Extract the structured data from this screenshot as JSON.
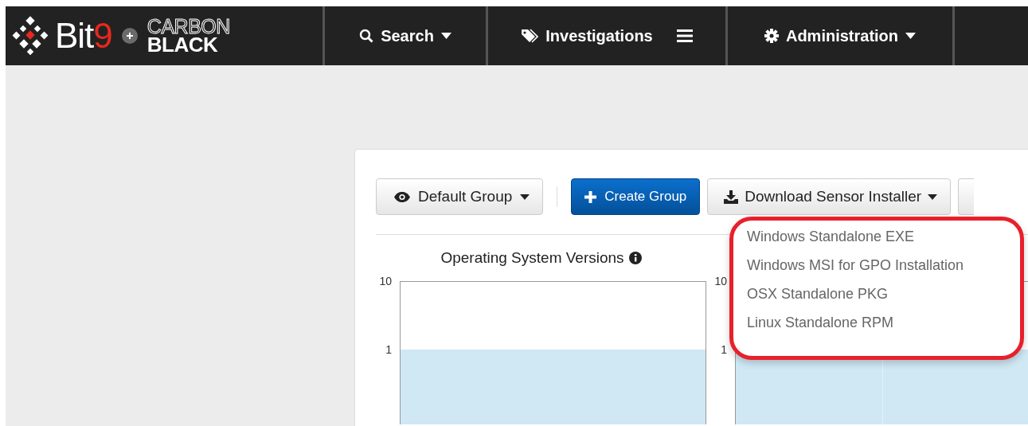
{
  "navbar": {
    "logo": {
      "brand": "Bit9",
      "partner_top": "CARBON",
      "partner_bottom": "BLACK"
    },
    "items": [
      {
        "label": "Search",
        "kind": "dropdown"
      },
      {
        "label": "Investigations",
        "kind": "menu"
      },
      {
        "label": "Administration",
        "kind": "dropdown"
      }
    ]
  },
  "toolbar": {
    "group_select": {
      "label": "Default Group"
    },
    "create_button": {
      "label": "Create Group"
    },
    "download_button": {
      "label": "Download Sensor Installer"
    },
    "download_menu": {
      "highlighted": true,
      "items": [
        "Windows Standalone EXE",
        "Windows MSI for GPO Installation",
        "OSX Standalone PKG",
        "Linux Standalone RPM"
      ]
    }
  },
  "charts": [
    {
      "title": "Operating System Versions",
      "tick_labels": [
        "10",
        "1"
      ]
    },
    {
      "tick_labels": [
        "10",
        "1"
      ]
    }
  ]
}
